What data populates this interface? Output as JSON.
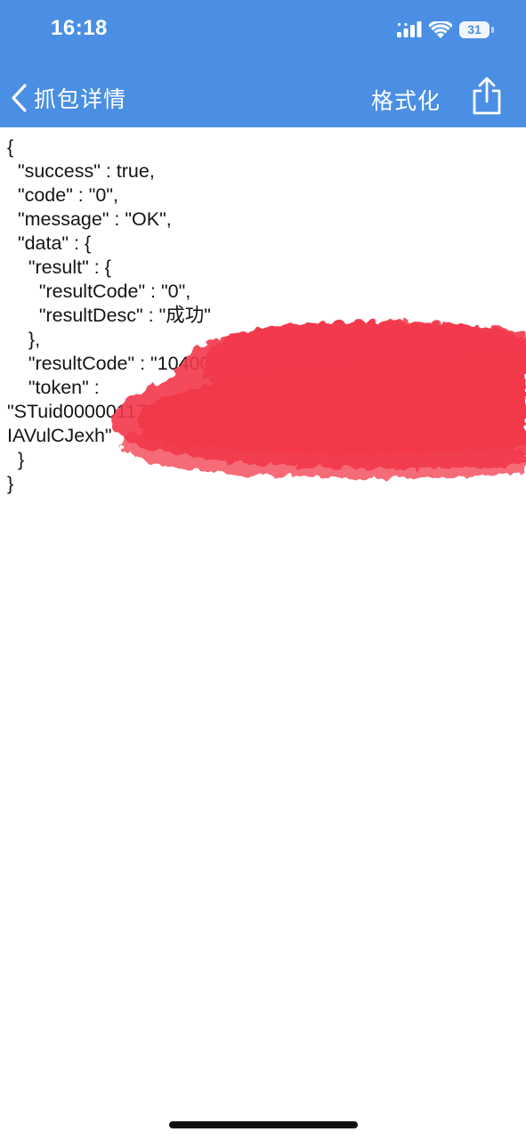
{
  "status_bar": {
    "time": "16:18",
    "battery": "31",
    "icons": [
      "signal-icon",
      "wifi-icon",
      "battery-icon"
    ]
  },
  "nav": {
    "back_label": "抓包详情",
    "format_label": "格式化",
    "share_icon": "share-icon"
  },
  "json_lines": [
    "{",
    "  \"success\" : true,",
    "  \"code\" : \"0\",",
    "  \"message\" : \"OK\",",
    "  \"data\" : {",
    "    \"result\" : {",
    "      \"resultCode\" : \"0\",",
    "      \"resultDesc\" : \"成功\"",
    "    },",
    "    \"resultCode\" : \"104000\"",
    "    \"token\" :",
    "\"STuid0000011732",
    "IAVulCJexh\"",
    "  }",
    "}"
  ],
  "colors": {
    "header_bg": "#4a8fe3",
    "redaction": "#f2394a"
  }
}
